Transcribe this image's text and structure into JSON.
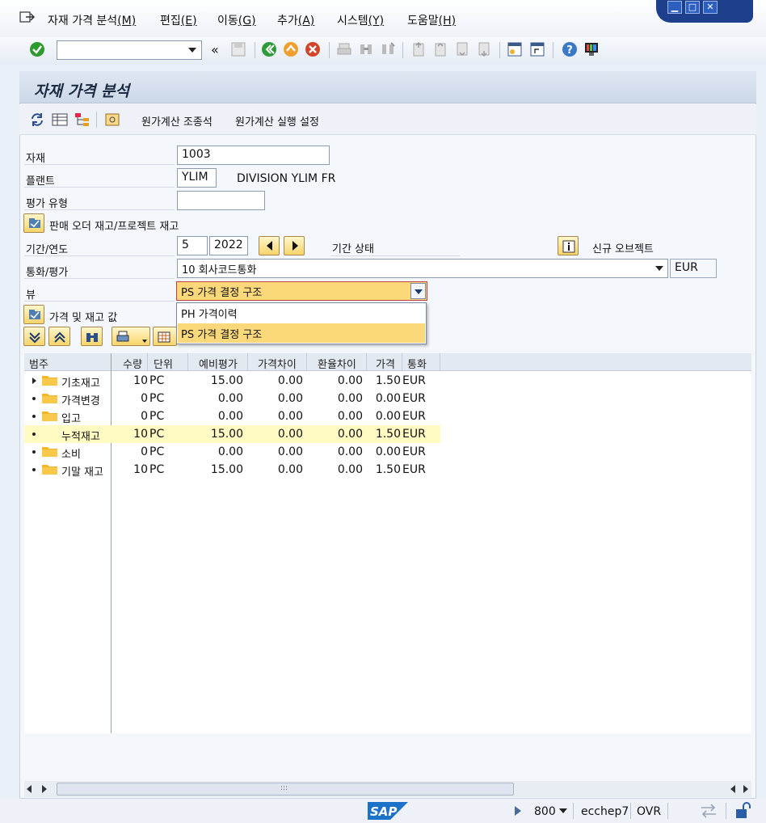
{
  "menu": {
    "items": [
      {
        "label": "자재 가격 분석",
        "key": "(M)"
      },
      {
        "label": "편집",
        "key": "(E)"
      },
      {
        "label": "이동",
        "key": "(G)"
      },
      {
        "label": "추가",
        "key": "(A)"
      },
      {
        "label": "시스템",
        "key": "(Y)"
      },
      {
        "label": "도움말",
        "key": "(H)"
      }
    ]
  },
  "toolbar": {
    "command_field_value": "",
    "history_label": "«"
  },
  "screen": {
    "title": "자재 가격 분석",
    "app_buttons": [
      "원가계산 조종석",
      "원가계산 실행 설정"
    ]
  },
  "form": {
    "material": {
      "label": "자재",
      "value": "1003"
    },
    "plant": {
      "label": "플랜트",
      "value": "YLIM",
      "description": "DIVISION YLIM FR"
    },
    "valuation_type": {
      "label": "평가 유형",
      "value": ""
    },
    "sales_order_stock_label": "판매 오더 재고/프로젝트 재고",
    "period": {
      "label": "기간/연도",
      "period": "5",
      "year": "2022",
      "status_label": "기간 상태",
      "new_object_label": "신규 오브젝트"
    },
    "currency": {
      "label": "통화/평가",
      "value": "10 회사코드통화",
      "unit": "EUR"
    },
    "view": {
      "label": "뷰",
      "value": "PS 가격 결정 구조",
      "options": [
        "PH 가격이력",
        "PS 가격 결정 구조"
      ]
    },
    "prices_label": "가격 및 재고 값"
  },
  "grid": {
    "columns": [
      "범주",
      "수량",
      "단위",
      "예비평가",
      "가격차이",
      "환율차이",
      "가격",
      "통화"
    ],
    "rows": [
      {
        "category": "기초재고",
        "qty": "10",
        "unit": "PC",
        "prelim": "15.00",
        "price_diff": "0.00",
        "fx_diff": "0.00",
        "price": "1.50",
        "currency": "EUR",
        "marker": "arrow",
        "folder": true
      },
      {
        "category": "가격변경",
        "qty": "0",
        "unit": "PC",
        "prelim": "0.00",
        "price_diff": "0.00",
        "fx_diff": "0.00",
        "price": "0.00",
        "currency": "EUR",
        "marker": "dot",
        "folder": true
      },
      {
        "category": "입고",
        "qty": "0",
        "unit": "PC",
        "prelim": "0.00",
        "price_diff": "0.00",
        "fx_diff": "0.00",
        "price": "0.00",
        "currency": "EUR",
        "marker": "dot",
        "folder": true
      },
      {
        "category": "누적재고",
        "qty": "10",
        "unit": "PC",
        "prelim": "15.00",
        "price_diff": "0.00",
        "fx_diff": "0.00",
        "price": "1.50",
        "currency": "EUR",
        "marker": "dot",
        "folder": false,
        "highlight": true
      },
      {
        "category": "소비",
        "qty": "0",
        "unit": "PC",
        "prelim": "0.00",
        "price_diff": "0.00",
        "fx_diff": "0.00",
        "price": "0.00",
        "currency": "EUR",
        "marker": "dot",
        "folder": true
      },
      {
        "category": "기말 재고",
        "qty": "10",
        "unit": "PC",
        "prelim": "15.00",
        "price_diff": "0.00",
        "fx_diff": "0.00",
        "price": "1.50",
        "currency": "EUR",
        "marker": "dot",
        "folder": true
      }
    ]
  },
  "status": {
    "sap_logo": "SAP",
    "client": "800",
    "system": "ecchep7",
    "mode": "OVR"
  },
  "colors": {
    "highlight_row": "#fffbc2",
    "selected_option": "#fbd87a",
    "brand_blue": "#1d3f8c"
  }
}
